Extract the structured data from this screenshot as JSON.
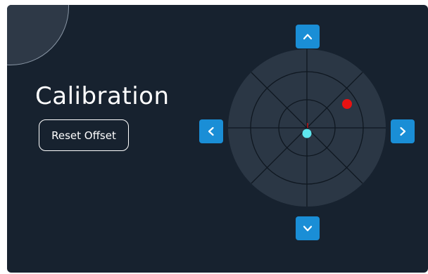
{
  "screen": {
    "title": "Calibration"
  },
  "controls": {
    "reset_offset_label": "Reset Offset",
    "back_icon": "back-arrow-icon",
    "up_icon": "chevron-up-icon",
    "down_icon": "chevron-down-icon",
    "left_icon": "chevron-left-icon",
    "right_icon": "chevron-right-icon"
  },
  "target": {
    "rings": 3,
    "marker_color": "#e81212",
    "center_color": "#5ee6ee",
    "offset_marker_label": "current offset marker",
    "center_label": "center reference"
  },
  "colors": {
    "background": "#17222f",
    "target_disc": "#2b3745",
    "accent_blue": "#1a8ed6",
    "text": "#ffffff"
  }
}
